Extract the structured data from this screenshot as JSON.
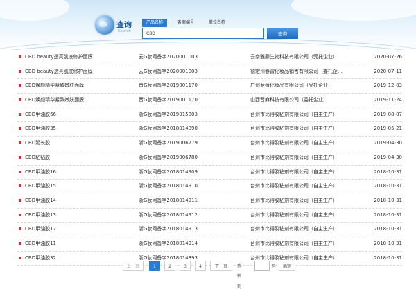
{
  "header": {
    "logo_title": "查询",
    "logo_subtitle": "Search",
    "tabs": [
      {
        "label": "产品名称"
      },
      {
        "label": "备案编号"
      },
      {
        "label": "单位名称"
      }
    ],
    "search_value": "CBD",
    "search_button": "查询"
  },
  "results": [
    {
      "name": "CBD beauty透亮肌底修护面膜",
      "reg": "云G妆网备字2020001003",
      "company": "云南雅藤生物科技有限公司（受托企业）",
      "date": "2020-07-26"
    },
    {
      "name": "CBD beauty透亮肌底修护面膜",
      "reg": "云G妆网备字2020001003",
      "company": "德宏州春雷化妆品销售有限公司（委托企…",
      "date": "2020-07-11"
    },
    {
      "name": "CBD焕颜精华紧致嫩肤面膜",
      "reg": "晋G妆网备字2019001170",
      "company": "广州萝薇化妆品有限公司（受托企业）",
      "date": "2019-12-03"
    },
    {
      "name": "CBD焕颜精华紧致嫩肤面膜",
      "reg": "晋G妆网备字2019001170",
      "company": "山西晋麻科技有限公司（委托企业）",
      "date": "2019-11-24"
    },
    {
      "name": "CBD甲油胶66",
      "reg": "浙G妆网备字2019015803",
      "company": "台州市比得胶粘剂有限公司（自主生产）",
      "date": "2019-08-07"
    },
    {
      "name": "CBD甲油胶35",
      "reg": "浙G妆网备字2018014890",
      "company": "台州市比得胶粘剂有限公司（自主生产）",
      "date": "2019-05-21"
    },
    {
      "name": "CBD延长胶",
      "reg": "浙G妆网备字2019006779",
      "company": "台州市比得胶粘剂有限公司（自主生产）",
      "date": "2019-04-30"
    },
    {
      "name": "CBD粘钻胶",
      "reg": "浙G妆网备字2019006780",
      "company": "台州市比得胶粘剂有限公司（自主生产）",
      "date": "2019-04-30"
    },
    {
      "name": "CBD甲油胶16",
      "reg": "浙G妆网备字2018014909",
      "company": "台州市比得胶粘剂有限公司（自主生产）",
      "date": "2018-10-31"
    },
    {
      "name": "CBD甲油胶15",
      "reg": "浙G妆网备字2018014910",
      "company": "台州市比得胶粘剂有限公司（自主生产）",
      "date": "2018-10-31"
    },
    {
      "name": "CBD甲油胶14",
      "reg": "浙G妆网备字2018014911",
      "company": "台州市比得胶粘剂有限公司（自主生产）",
      "date": "2018-10-31"
    },
    {
      "name": "CBD甲油胶13",
      "reg": "浙G妆网备字2018014912",
      "company": "台州市比得胶粘剂有限公司（自主生产）",
      "date": "2018-10-31"
    },
    {
      "name": "CBD甲油胶12",
      "reg": "浙G妆网备字2018014913",
      "company": "台州市比得胶粘剂有限公司（自主生产）",
      "date": "2018-10-31"
    },
    {
      "name": "CBD甲油胶11",
      "reg": "浙G妆网备字2018014914",
      "company": "台州市比得胶粘剂有限公司（自主生产）",
      "date": "2018-10-31"
    },
    {
      "name": "CBD甲油胶32",
      "reg": "浙G妆网备字2018014893",
      "company": "台州市比得胶粘剂有限公司（自主生产）",
      "date": "2018-10-31"
    }
  ],
  "pagination": {
    "prev": "上一页",
    "pages": [
      "1",
      "2",
      "3",
      "4"
    ],
    "current": "1",
    "next": "下一页",
    "jump_label": "我转到",
    "page_unit": "页",
    "confirm": "确定"
  }
}
